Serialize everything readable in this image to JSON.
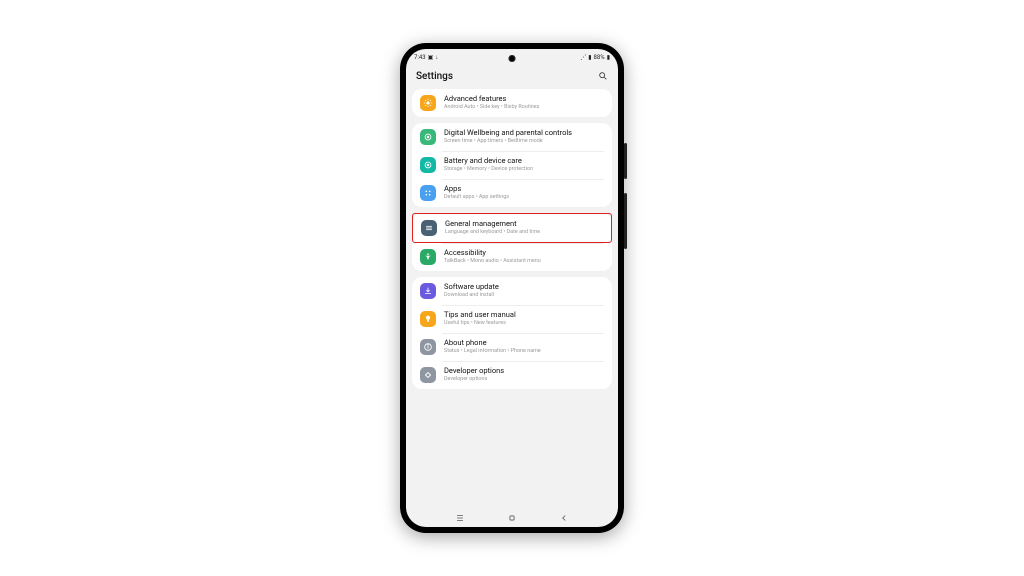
{
  "status": {
    "time": "7:43",
    "batt": "88%"
  },
  "header": {
    "title": "Settings"
  },
  "colors": {
    "adv": "#f7a61b",
    "dwb": "#3ab87a",
    "batt": "#13b9a4",
    "apps": "#4aa0f0",
    "gm": "#4a6073",
    "acc": "#2aa866",
    "sw": "#6a5ae0",
    "tips": "#f7a61b",
    "about": "#8d96a1",
    "dev": "#8d96a1"
  },
  "groups": [
    {
      "items": [
        {
          "key": "adv",
          "title": "Advanced features",
          "sub": "Android Auto  •  Side key  •  Bixby Routines"
        }
      ]
    },
    {
      "items": [
        {
          "key": "dwb",
          "title": "Digital Wellbeing and parental controls",
          "sub": "Screen time  •  App timers  •  Bedtime mode"
        },
        {
          "key": "batt",
          "title": "Battery and device care",
          "sub": "Storage  •  Memory  •  Device protection"
        },
        {
          "key": "apps",
          "title": "Apps",
          "sub": "Default apps  •  App settings"
        }
      ]
    },
    {
      "items": [
        {
          "key": "gm",
          "title": "General management",
          "sub": "Language and keyboard  •  Date and time",
          "hl": true
        },
        {
          "key": "acc",
          "title": "Accessibility",
          "sub": "TalkBack  •  Mono audio  •  Assistant menu"
        }
      ]
    },
    {
      "items": [
        {
          "key": "sw",
          "title": "Software update",
          "sub": "Download and install"
        },
        {
          "key": "tips",
          "title": "Tips and user manual",
          "sub": "Useful tips  •  New features"
        },
        {
          "key": "about",
          "title": "About phone",
          "sub": "Status  •  Legal information  •  Phone name"
        },
        {
          "key": "dev",
          "title": "Developer options",
          "sub": "Developer options"
        }
      ]
    }
  ]
}
